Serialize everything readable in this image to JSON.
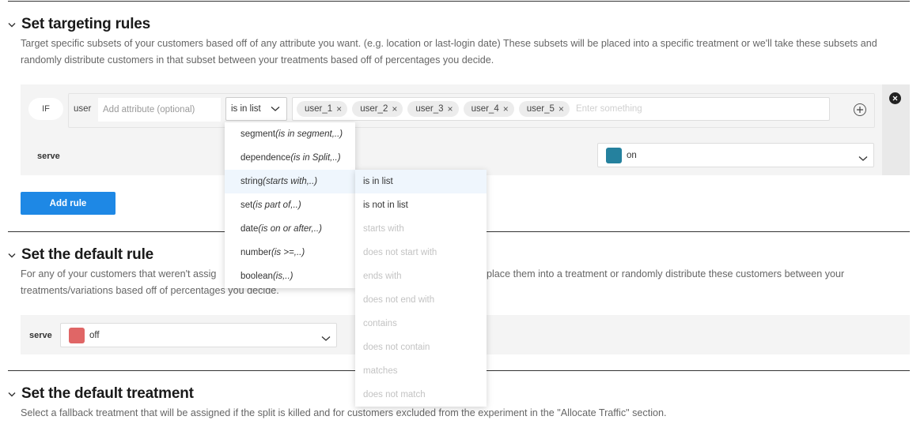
{
  "targeting": {
    "title": "Set targeting rules",
    "description": "Target specific subsets of your customers based off of any attribute you want. (e.g. location or last-login date) These subsets will be placed into a specific treatment or we'll take these subsets and randomly distribute customers in that subset between your treatments based off of percentages you decide.",
    "rule": {
      "if_label": "IF",
      "subject": "user",
      "attribute_placeholder": "Add attribute (optional)",
      "attribute_value": "",
      "matcher": "is in list",
      "values": [
        "user_1",
        "user_2",
        "user_3",
        "user_4",
        "user_5"
      ],
      "values_placeholder": "Enter something",
      "serve_label": "serve",
      "serve_treatment": "on",
      "serve_color": "#25819e"
    },
    "add_rule_label": "Add rule"
  },
  "matcher_menu": {
    "items": [
      {
        "type": "segment",
        "hint": "(is in segment,..)"
      },
      {
        "type": "dependence",
        "hint": "(is in Split,..)"
      },
      {
        "type": "string",
        "hint": "(starts with,..)",
        "active": true
      },
      {
        "type": "set",
        "hint": "(is part of,..)"
      },
      {
        "type": "date",
        "hint": "(is on or after,..)"
      },
      {
        "type": "number",
        "hint": "(is >=,..)"
      },
      {
        "type": "boolean",
        "hint": "(is,..)"
      }
    ],
    "string_submenu": [
      {
        "label": "is in list",
        "enabled": true,
        "active": true
      },
      {
        "label": "is not in list",
        "enabled": true
      },
      {
        "label": "starts with",
        "enabled": false
      },
      {
        "label": "does not start with",
        "enabled": false
      },
      {
        "label": "ends with",
        "enabled": false
      },
      {
        "label": "does not end with",
        "enabled": false
      },
      {
        "label": "contains",
        "enabled": false
      },
      {
        "label": "does not contain",
        "enabled": false
      },
      {
        "label": "matches",
        "enabled": false
      },
      {
        "label": "does not match",
        "enabled": false
      }
    ]
  },
  "default_rule": {
    "title": "Set the default rule",
    "description_visible_start": "For any of your customers that weren't assig",
    "description_visible_end": "place them into a treatment or randomly distribute these customers between your",
    "description_line2": "treatments/variations based off of percentages you decide.",
    "serve_label": "serve",
    "serve_treatment": "off",
    "serve_color": "#e06666"
  },
  "default_treatment": {
    "title": "Set the default treatment",
    "description": "Select a fallback treatment that will be assigned if the split is killed and for customers excluded from the experiment in the \"Allocate Traffic\" section."
  }
}
